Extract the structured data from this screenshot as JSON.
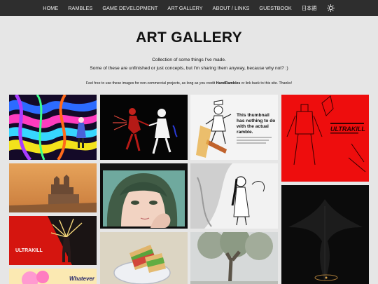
{
  "nav": {
    "items": [
      "HOME",
      "RAMBLES",
      "GAME DEVELOPMENT",
      "ART GALLERY",
      "ABOUT / LINKS",
      "GUESTBOOK",
      "日本語"
    ],
    "theme_icon": "sun-icon"
  },
  "page": {
    "title": "ART GALLERY",
    "intro_line1": "Collection of some things I've made.",
    "intro_line2": "Some of these are unfinished or just concepts, but I'm sharing them anyway, because why not? :)",
    "license_before": "Feel free to use these images for non-commercial projects, as long as you credit ",
    "license_credit": "HandRambles",
    "license_after": " or link back to this site. Thanks!"
  },
  "gallery": {
    "thumbnail_joke": "This thumbnail has nothing to do with the actual ramble.",
    "ultrakill_label": "ULTRAKILL",
    "ultrakill_label_2": "ULTRAKILL",
    "whatever_label": "Whatever"
  },
  "colors": {
    "nav_bg": "#2e2e2e",
    "page_bg": "#e6e6e6",
    "accent_red": "#ee0d0d"
  }
}
